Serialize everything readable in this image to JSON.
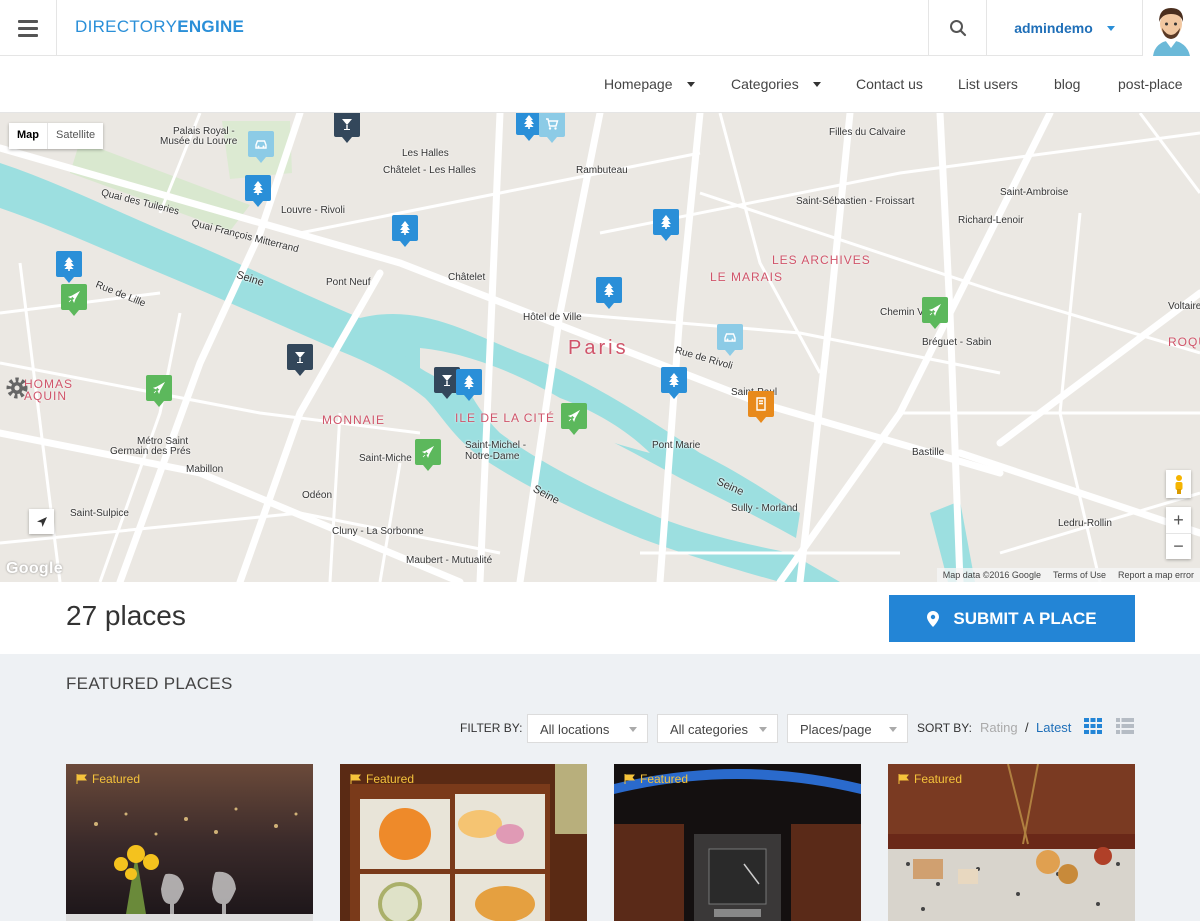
{
  "header": {
    "logo_light": "DIRECTORY",
    "logo_bold": "ENGINE",
    "user_name": "admindemo"
  },
  "nav": {
    "items": [
      {
        "label": "Homepage"
      },
      {
        "label": "Categories"
      },
      {
        "label": "Contact us"
      },
      {
        "label": "List users"
      },
      {
        "label": "blog"
      },
      {
        "label": "post-place"
      }
    ]
  },
  "map": {
    "type_map": "Map",
    "type_satellite": "Satellite",
    "city": "Paris",
    "google": "Google",
    "attribution": {
      "data": "Map data ©2016 Google",
      "terms": "Terms of Use",
      "report": "Report a map error"
    },
    "labels": {
      "palais": "Palais Royal -",
      "louvre_museum": "Musée du Louvre",
      "les_halles": "Les Halles",
      "chatelet_les_halles": "Châtelet - Les Halles",
      "rambuteau": "Rambuteau",
      "filles_calvaire": "Filles du Calvaire",
      "saint_sebastien": "Saint-Sébastien - Froissart",
      "saint_ambroise": "Saint-Ambroise",
      "richard_lenoir": "Richard-Lenoir",
      "louvre_rivoli": "Louvre - Rivoli",
      "chatelet": "Châtelet",
      "pont_neuf": "Pont Neuf",
      "hotel_de_ville": "Hôtel de Ville",
      "chemin_vert": "Chemin V",
      "breguet_sabin": "Bréguet - Sabin",
      "saint_paul": "Saint-Paul",
      "mabillon": "Mabillon",
      "metro_saint_germain_1": "Métro Saint",
      "metro_saint_germain_2": "Germain des Prés",
      "saint_michel": "Saint-Miche",
      "saint_michel_nd_1": "Saint-Michel -",
      "saint_michel_nd_2": "Notre-Dame",
      "pont_marie": "Pont Marie",
      "bastille": "Bastille",
      "odeon": "Odéon",
      "saint_sulpice": "Saint-Sulpice",
      "cluny": "Cluny - La Sorbonne",
      "maubert": "Maubert - Mutualité",
      "sully": "Sully - Morland",
      "ledru": "Ledru-Rollin",
      "voltaire": "Voltaire",
      "seine": "Seine",
      "quai_tuileries": "Quai des Tuileries",
      "quai_mitterrand": "Quai François Mitterrand",
      "rue_de_rivoli": "Rue de Rivoli",
      "rue_de_lille": "Rue de Lille"
    },
    "districts": {
      "le_marais": "LE MARAIS",
      "les_archives": "LES ARCHIVES",
      "ile_de_la_cite": "ILE DE LA CITÉ",
      "monnaie": "MONNAIE",
      "roque": "ROQU",
      "thomas": "HOMAS",
      "aquin": "AQUIN"
    }
  },
  "summary": {
    "count": "27 places",
    "submit_label": "SUBMIT A PLACE"
  },
  "featured": {
    "title": "FEATURED PLACES",
    "filter_label": "FILTER BY:",
    "locations": "All locations",
    "categories": "All categories",
    "per_page": "Places/page",
    "sort_label": "SORT BY:",
    "sort_rating": "Rating",
    "sort_sep": "/",
    "sort_latest": "Latest",
    "badge": "Featured"
  },
  "colors": {
    "accent": "#2385d6",
    "pin_blue": "#2a8fd8",
    "pin_dark": "#33475b",
    "pin_green": "#5cb85c",
    "pin_orange": "#e88a1c",
    "pin_light": "#8ccbe6",
    "water": "#9cdfe0",
    "featured_badge": "#f5c33b"
  }
}
